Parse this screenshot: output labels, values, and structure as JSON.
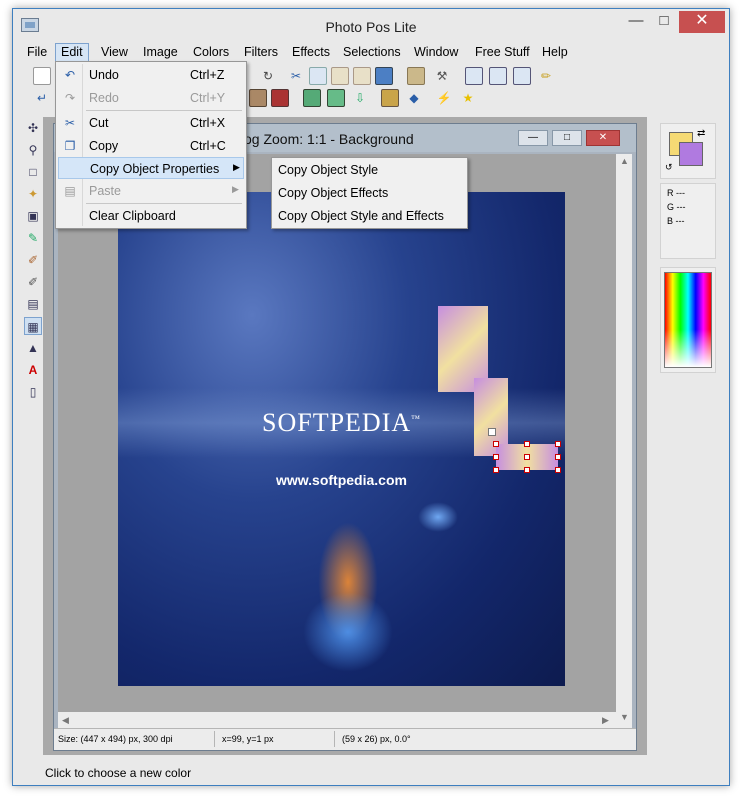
{
  "window": {
    "title": "Photo Pos Lite",
    "controls": {
      "minimize": "—",
      "maximize": "□",
      "close": "✕"
    }
  },
  "menubar": {
    "items": [
      "File",
      "Edit",
      "View",
      "Image",
      "Colors",
      "Filters",
      "Effects",
      "Selections",
      "Window",
      "Free Stuff",
      "Help"
    ],
    "active": "Edit"
  },
  "edit_menu": {
    "items": [
      {
        "label": "Undo",
        "shortcut": "Ctrl+Z",
        "icon": "undo-icon",
        "enabled": true
      },
      {
        "label": "Redo",
        "shortcut": "Ctrl+Y",
        "icon": "redo-icon",
        "enabled": false
      },
      {
        "label": "Cut",
        "shortcut": "Ctrl+X",
        "icon": "scissors-icon",
        "enabled": true
      },
      {
        "label": "Copy",
        "shortcut": "Ctrl+C",
        "icon": "copy-icon",
        "enabled": true
      },
      {
        "label": "Copy Object Properties",
        "shortcut": "",
        "icon": "",
        "enabled": true,
        "submenu": true,
        "highlighted": true
      },
      {
        "label": "Paste",
        "shortcut": "",
        "icon": "paste-icon",
        "enabled": false,
        "submenu": true
      },
      {
        "label": "Clear Clipboard",
        "shortcut": "",
        "icon": "",
        "enabled": true
      }
    ]
  },
  "copy_props_submenu": {
    "items": [
      "Copy Object Style",
      "Copy Object Effects",
      "Copy Object Style and Effects"
    ]
  },
  "document": {
    "title": "og  Zoom: 1:1 - Background",
    "image_text": "SOFTPEDIA",
    "trademark": "™",
    "image_url": "www.softpedia.com",
    "status": {
      "size": "Size: (447 x 494) px, 300 dpi",
      "coords": "x=99, y=1 px",
      "object": "(59 x 26) px, 0.0°"
    }
  },
  "color_panel": {
    "r_label": "R ---",
    "g_label": "G ---",
    "b_label": "B ---",
    "foreground": "#f5da74",
    "background": "#b07ae0"
  },
  "statusbar": {
    "text": "Click to choose a new color"
  },
  "colors": {
    "accent": "#3e7fbf",
    "close_red": "#c75050",
    "highlight": "#d5e6f8"
  }
}
